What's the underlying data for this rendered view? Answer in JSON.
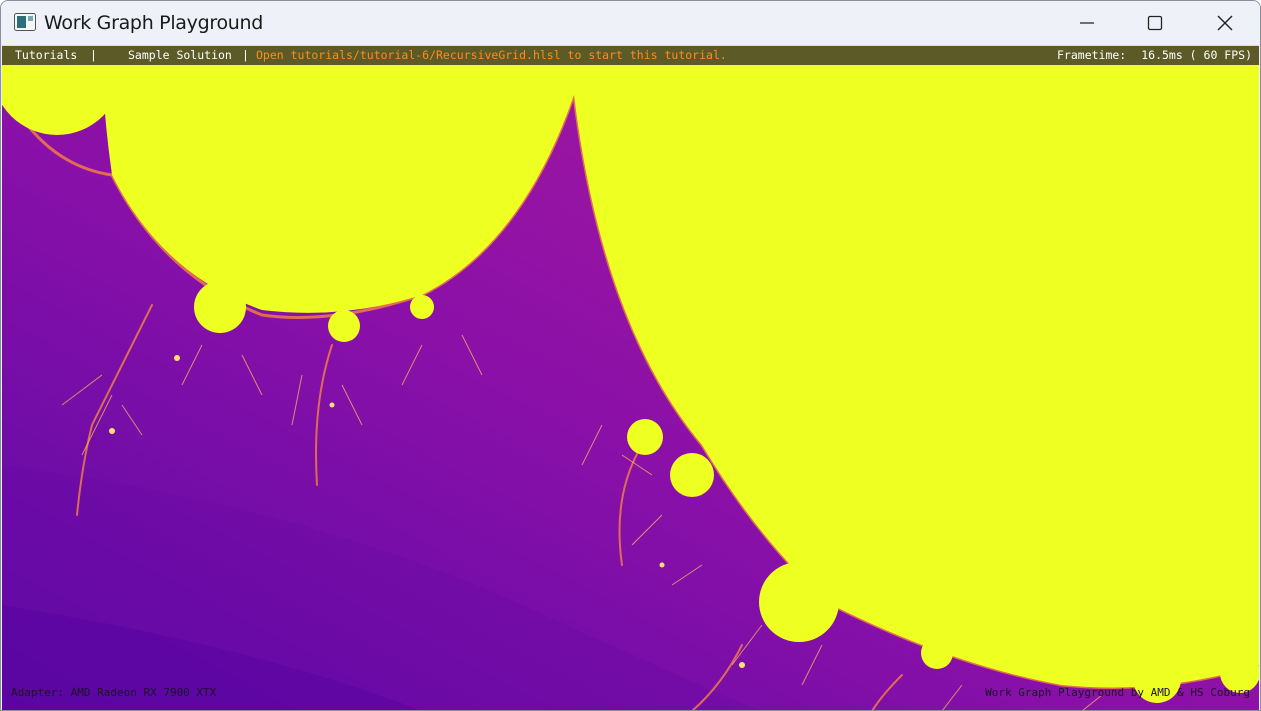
{
  "window": {
    "title": "Work Graph Playground",
    "controls": [
      "minimize-icon",
      "maximize-icon",
      "close-icon"
    ]
  },
  "menubar": {
    "items": [
      {
        "label": "Tutorials"
      },
      {
        "label": "Sample Solution"
      }
    ],
    "separator": "|",
    "hint": "Open tutorials/tutorial-6/RecursiveGrid.hlsl to start this tutorial.",
    "frametime_label": "Frametime:",
    "frametime_value": "16.5ms ( 60 FPS)"
  },
  "footer": {
    "adapter": "Adapter: AMD Radeon RX 7900 XTX",
    "credit": "Work Graph Playground by AMD & HS Coburg"
  },
  "colors": {
    "fractal_interior": "#eeff22",
    "fractal_dark": "#6a0aa8",
    "fractal_mid": "#9c18a4",
    "fractal_edge": "#ff9a3a",
    "hint_text": "#ff8c1a"
  }
}
